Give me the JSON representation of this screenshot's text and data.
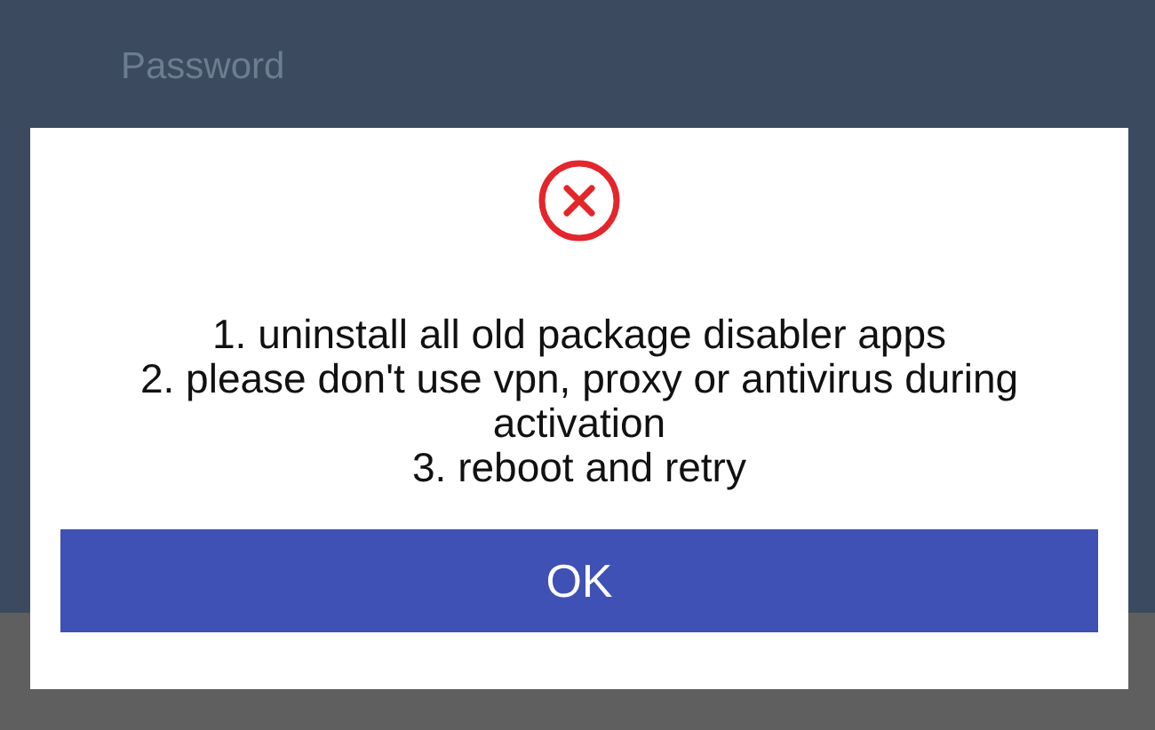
{
  "login": {
    "password_field": {
      "placeholder": "Password"
    }
  },
  "dialog": {
    "messages": [
      "1. uninstall all old package disabler apps",
      "2. please don't use vpn, proxy or antivirus during activation",
      "3. reboot and retry"
    ],
    "button": "OK"
  }
}
